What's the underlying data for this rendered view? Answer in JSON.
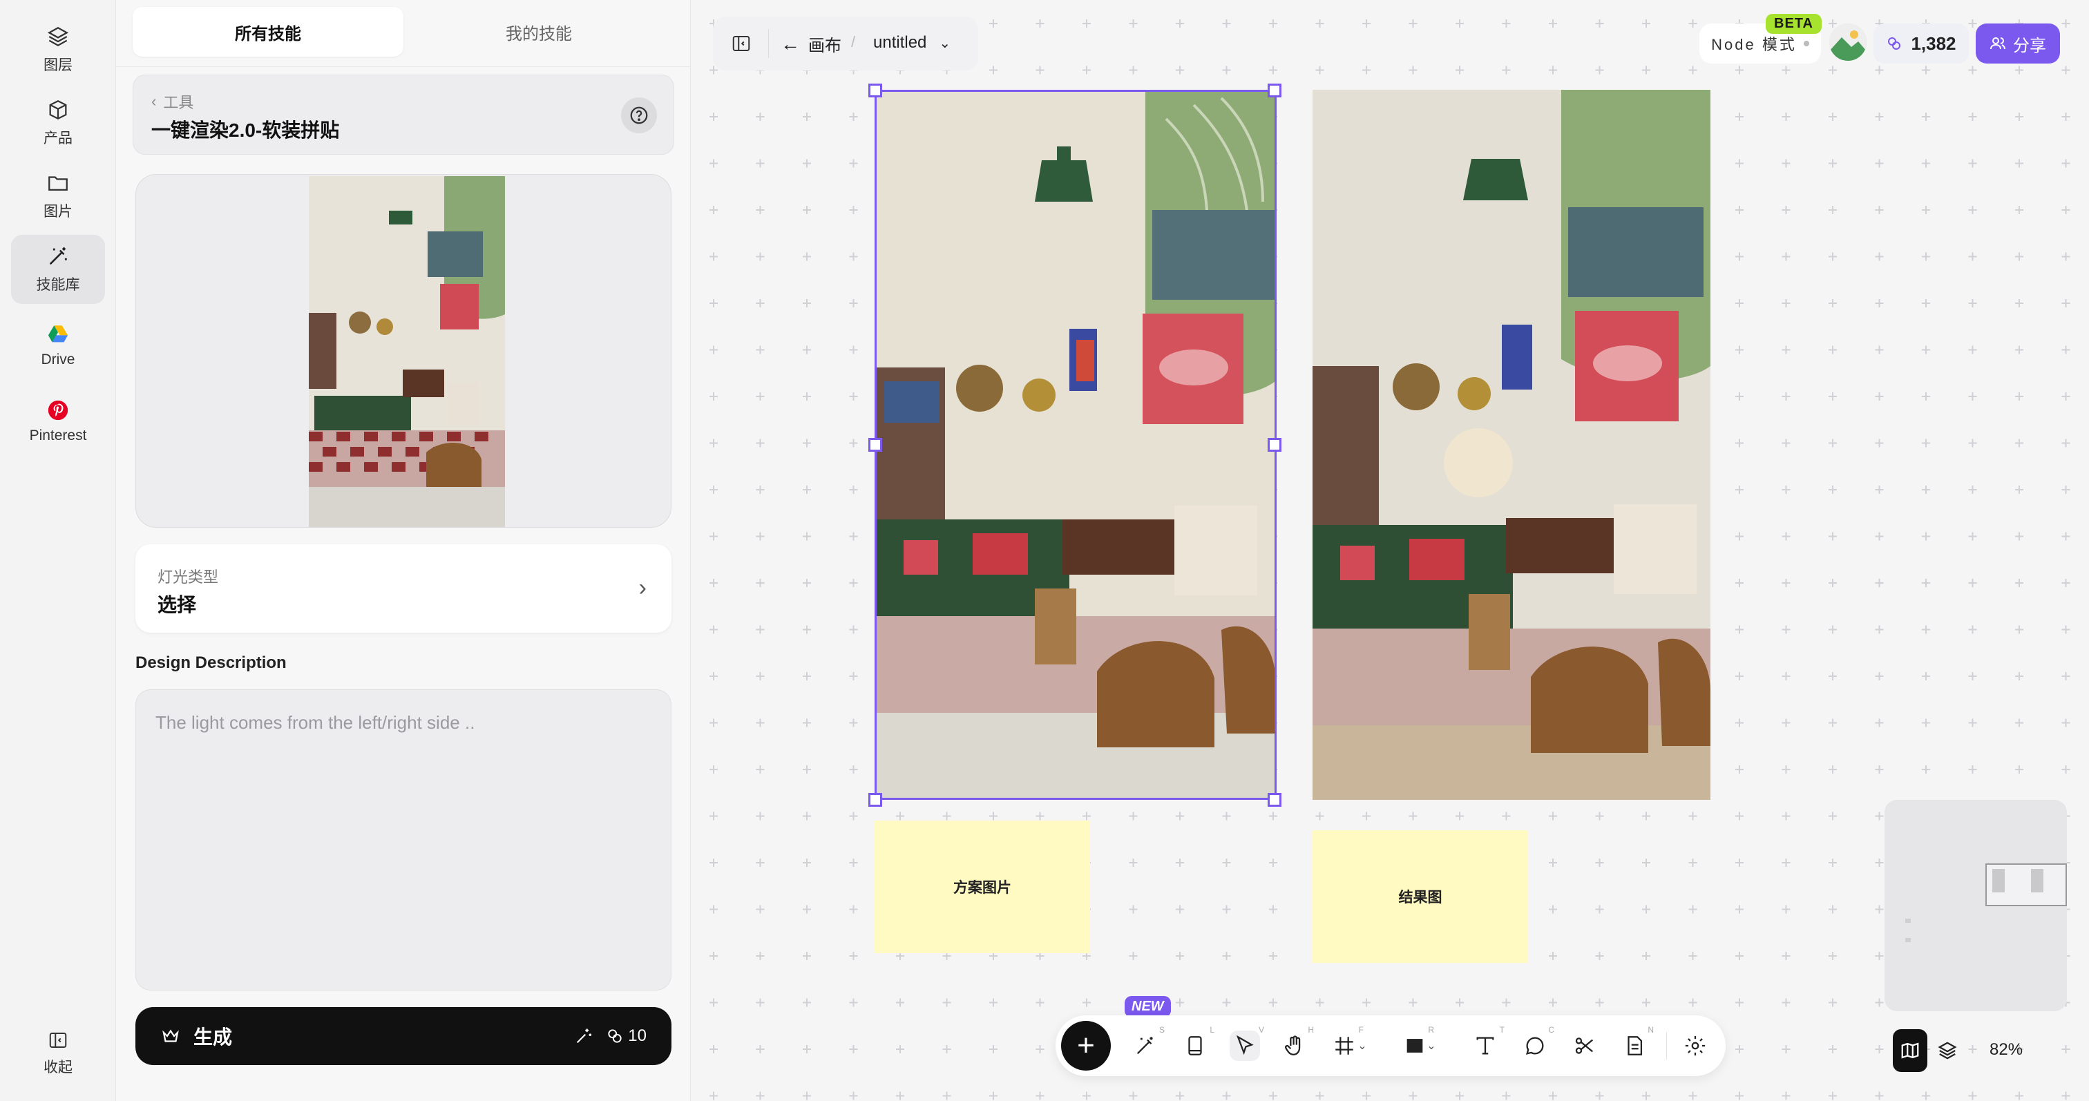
{
  "rail": {
    "items": [
      {
        "label": "图层",
        "icon": "layers-icon"
      },
      {
        "label": "产品",
        "icon": "cube-icon"
      },
      {
        "label": "图片",
        "icon": "folder-icon"
      },
      {
        "label": "技能库",
        "icon": "magic-wand-icon"
      },
      {
        "label": "Drive",
        "icon": "google-drive-icon"
      },
      {
        "label": "Pinterest",
        "icon": "pinterest-icon"
      }
    ],
    "collapse_label": "收起"
  },
  "panel": {
    "tabs": [
      "所有技能",
      "我的技能"
    ],
    "tool_back": "工具",
    "tool_title": "一键渲染2.0-软装拼贴",
    "lighting_label": "灯光类型",
    "lighting_value": "选择",
    "desc_label": "Design Description",
    "desc_placeholder": "The light comes from the left/right side ..",
    "generate_label": "生成",
    "generate_cost": "10"
  },
  "topbar": {
    "back_label": "画布",
    "slash": "/",
    "file_title": "untitled"
  },
  "header_right": {
    "mode_label": "Node 模式",
    "beta": "BETA",
    "credits": "1,382",
    "share_label": "分享"
  },
  "canvas": {
    "sticky_left": "方案图片",
    "sticky_right": "结果图"
  },
  "toolbar": {
    "new_badge": "NEW",
    "keys": [
      "S",
      "L",
      "V",
      "H",
      "F",
      "R",
      "T",
      "C",
      "N"
    ]
  },
  "zoom": "82%",
  "colors": {
    "accent": "#7b58ee",
    "sticky": "#fff9c2",
    "beta": "#a6e22e"
  }
}
